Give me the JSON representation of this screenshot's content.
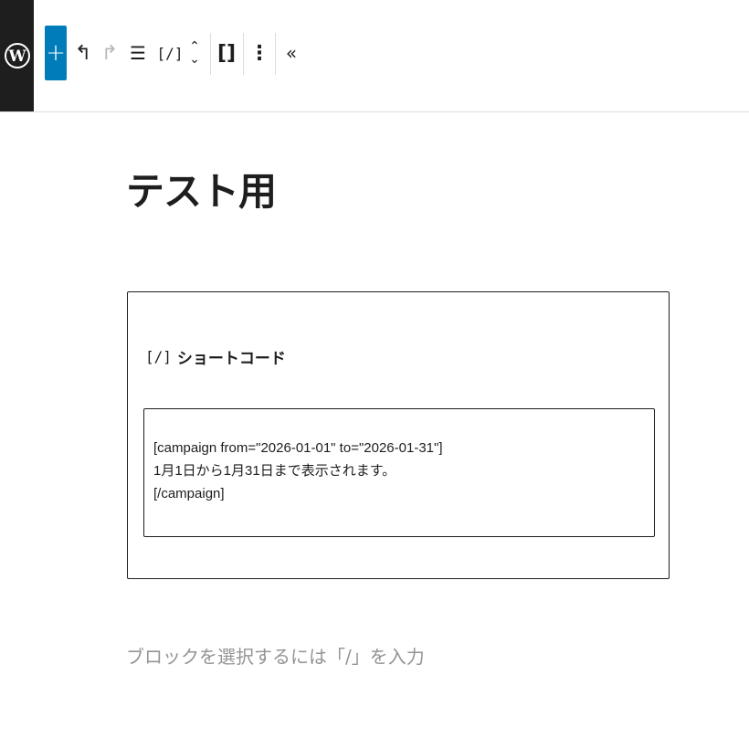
{
  "toolbar": {
    "logo_icon": "wordpress-logo-icon",
    "add_label": "+",
    "undo_glyph": "↰",
    "redo_glyph": "↱",
    "outline_glyph": "☰",
    "block_icon_glyph": "[/]",
    "move_up_glyph": "⌃",
    "move_down_glyph": "⌄",
    "block_type_glyph": "[]",
    "more_glyph": "⋮",
    "collapse_glyph": "«"
  },
  "page": {
    "title": "テスト用"
  },
  "shortcode_block": {
    "icon_glyph": "[/]",
    "label": "ショートコード",
    "content": "[campaign from=\"2026-01-01\" to=\"2026-01-31\"]\n1月1日から1月31日まで表示されます。\n[/campaign]"
  },
  "appender": {
    "placeholder": "ブロックを選択するには「/」を入力"
  }
}
